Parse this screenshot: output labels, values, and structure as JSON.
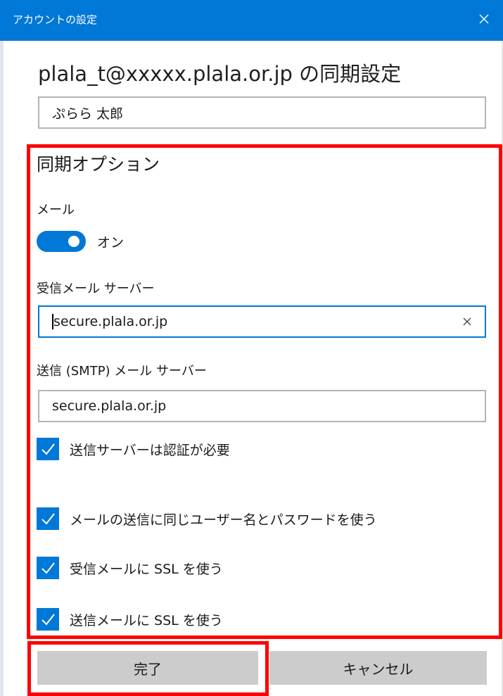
{
  "window": {
    "title": "アカウントの設定",
    "close_icon": "close-icon"
  },
  "header": {
    "heading": "plala_t@xxxxx.plala.or.jp の同期設定"
  },
  "account_name_field": {
    "value": "ぷらら 太郎"
  },
  "sync_options": {
    "title": "同期オプション",
    "mail_label": "メール",
    "mail_toggle": {
      "state": "on",
      "label": "オン"
    },
    "incoming_server": {
      "label": "受信メール サーバー",
      "value": "secure.plala.or.jp",
      "clear_icon": "clear-icon"
    },
    "outgoing_server": {
      "label": "送信 (SMTP) メール サーバー",
      "value": "secure.plala.or.jp"
    },
    "checkboxes": [
      {
        "label": "送信サーバーは認証が必要",
        "checked": true
      },
      {
        "label": "メールの送信に同じユーザー名とパスワードを使う",
        "checked": true
      },
      {
        "label": "受信メールに SSL を使う",
        "checked": true
      },
      {
        "label": "送信メールに SSL を使う",
        "checked": true
      }
    ]
  },
  "buttons": {
    "done": "完了",
    "cancel": "キャンセル"
  },
  "colors": {
    "accent": "#0078d7",
    "highlight_border": "#ff0000",
    "button_bg": "#cccccc"
  }
}
